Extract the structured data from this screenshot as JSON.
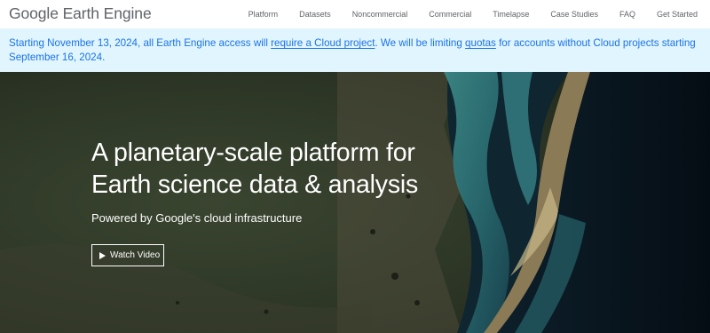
{
  "header": {
    "logo_text": "Google Earth Engine",
    "nav": [
      "Platform",
      "Datasets",
      "Noncommercial",
      "Commercial",
      "Timelapse",
      "Case Studies",
      "FAQ",
      "Get Started"
    ]
  },
  "banner": {
    "text_1": "Starting November 13, 2024, all Earth Engine access will ",
    "link_1": "require a Cloud project",
    "text_2": ". We will be limiting ",
    "link_2": "quotas",
    "text_3": " for accounts without Cloud projects starting September 16, 2024."
  },
  "hero": {
    "title": "A planetary-scale platform for Earth science data & analysis",
    "subtitle": "Powered by Google's cloud infrastructure",
    "button_label": "Watch Video"
  },
  "colors": {
    "link_blue": "#1a73e8",
    "banner_bg": "#e1f5fe",
    "nav_text": "#5f6368"
  },
  "icons": [
    "play-icon"
  ]
}
